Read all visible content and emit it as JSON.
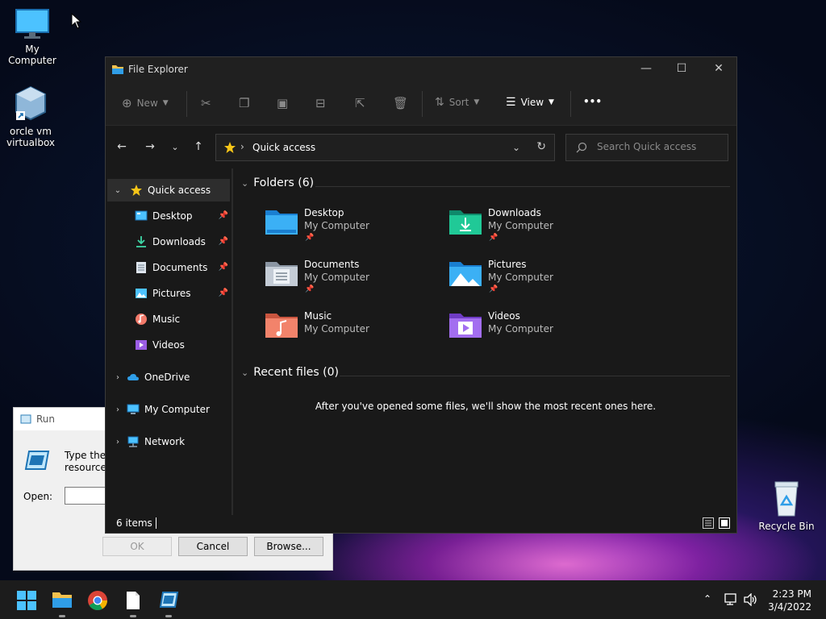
{
  "desktop": {
    "icons": {
      "my_computer": "My Computer",
      "virtualbox_line1": "orcle vm",
      "virtualbox_line2": "virtualbox",
      "recycle_bin": "Recycle Bin"
    }
  },
  "run_dialog": {
    "title": "Run",
    "message_line1": "Type the n",
    "message_line2": "resource, ",
    "open_label": "Open:",
    "open_value": "",
    "ok": "OK",
    "cancel": "Cancel",
    "browse": "Browse..."
  },
  "explorer": {
    "title": "File Explorer",
    "toolbar": {
      "new": "New",
      "sort": "Sort",
      "view": "View",
      "more": "•••"
    },
    "address": {
      "path": "Quick access"
    },
    "search": {
      "placeholder": "Search Quick access"
    },
    "sidebar": {
      "quick_access": "Quick access",
      "items": [
        {
          "label": "Desktop"
        },
        {
          "label": "Downloads"
        },
        {
          "label": "Documents"
        },
        {
          "label": "Pictures"
        },
        {
          "label": "Music"
        },
        {
          "label": "Videos"
        }
      ],
      "onedrive": "OneDrive",
      "my_computer": "My Computer",
      "network": "Network"
    },
    "folders_header": "Folders (6)",
    "folders": [
      {
        "name": "Desktop",
        "location": "My Computer"
      },
      {
        "name": "Downloads",
        "location": "My Computer"
      },
      {
        "name": "Documents",
        "location": "My Computer"
      },
      {
        "name": "Pictures",
        "location": "My Computer"
      },
      {
        "name": "Music",
        "location": "My Computer"
      },
      {
        "name": "Videos",
        "location": "My Computer"
      }
    ],
    "recent_header": "Recent files (0)",
    "recent_message": "After you've opened some files, we'll show the most recent ones here.",
    "status": {
      "count": "6 items"
    }
  },
  "taskbar": {
    "time": "2:23 PM",
    "date": "3/4/2022"
  },
  "colors": {
    "accent": "#0078d4",
    "folder_blue": "#2f9ee8",
    "folder_yellow": "#f2c14e"
  }
}
